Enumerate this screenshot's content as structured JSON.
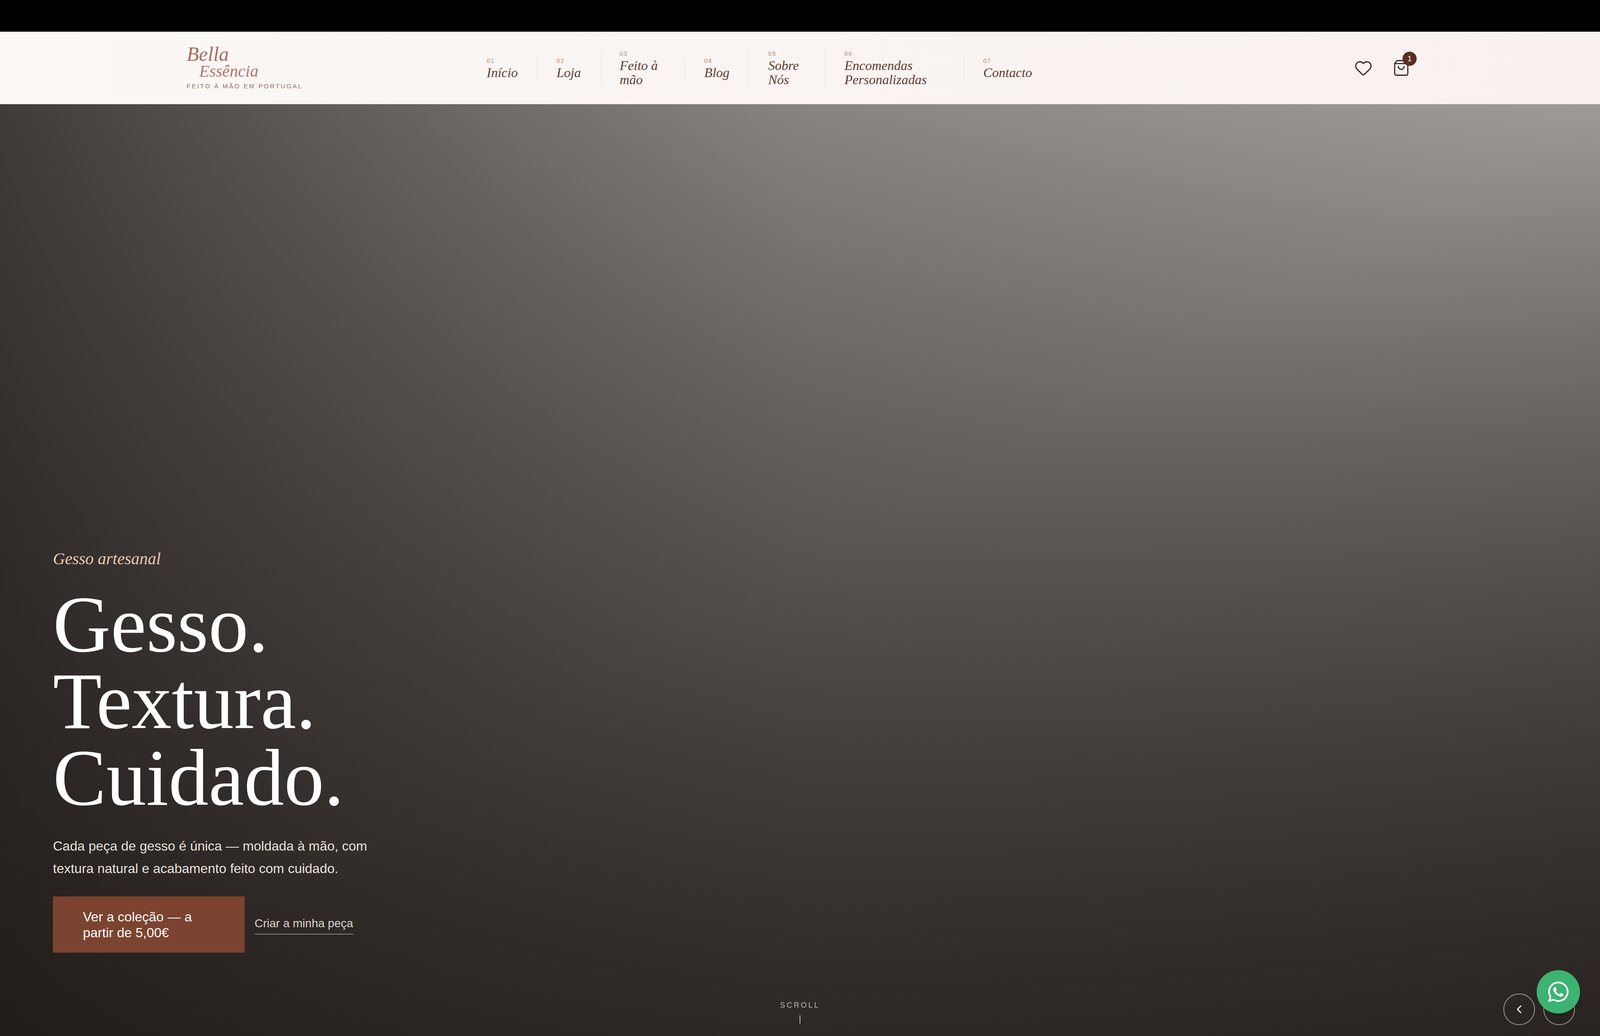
{
  "logo": {
    "line1": "Bella",
    "line2": "Essência",
    "tagline": "FEITO À MÃO EM PORTUGAL"
  },
  "nav": [
    {
      "number": "01",
      "label": "Início"
    },
    {
      "number": "02",
      "label": "Loja"
    },
    {
      "number": "03",
      "label": "Feito à mão"
    },
    {
      "number": "04",
      "label": "Blog"
    },
    {
      "number": "05",
      "label": "Sobre Nós"
    },
    {
      "number": "06",
      "label": "Encomendas Personalizadas"
    },
    {
      "number": "07",
      "label": "Contacto"
    }
  ],
  "header": {
    "cart_count": "1"
  },
  "hero": {
    "eyebrow": "Gesso artesanal",
    "title_lines": [
      "Gesso.",
      "Textura.",
      "Cuidado."
    ],
    "description": "Cada peça de gesso é única — moldada à mão, com textura natural e acabamento feito com cuidado.",
    "primary_button": "Ver a coleção — a partir de 5,00€",
    "secondary_link": "Criar a minha peça",
    "scroll_label": "SCROLL"
  }
}
